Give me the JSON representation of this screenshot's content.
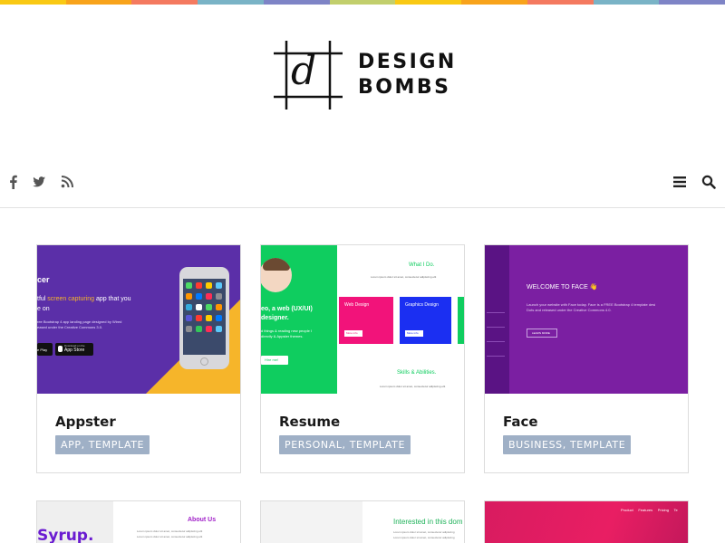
{
  "brand": {
    "name_line1": "DESIGN",
    "name_line2": "BOMBS",
    "logo_letter": "d"
  },
  "rainbow_colors": [
    "#f9c914",
    "#f8a31b",
    "#f47a60",
    "#7ab3c6",
    "#7e84c6",
    "#c2cf6d",
    "#f9c914",
    "#f8a31b",
    "#f47a60",
    "#7ab3c6",
    "#7e84c6"
  ],
  "toolbar": {
    "icons": [
      "facebook-icon",
      "twitter-icon",
      "rss-icon",
      "menu-icon",
      "search-icon"
    ]
  },
  "cards": [
    {
      "title": "Appster",
      "tags": "APP, TEMPLATE",
      "preview": {
        "heading": "cer",
        "line1a": "tful ",
        "line1b": "screen capturing",
        "line1c": " app that you",
        "line2": "e on",
        "small1": "ree Bootstrap 4 app landing page designed by Wired",
        "small2": "eased under the Creative Commons 3.0.",
        "store1": "e Play",
        "store2": "App Store",
        "store2_top": "Download on the"
      }
    },
    {
      "title": "Resume",
      "tags": "PERSONAL, TEMPLATE",
      "preview": {
        "intro1": "eo, a web (UX/UI)",
        "intro2": "designer.",
        "intro3": "d things & reading new people I",
        "intro4": "directly & Appster themes.",
        "button": "Hire me!",
        "what": "What I Do.",
        "lorem": "Lorem ipsum dolor sit amet, consectetur adipiscing elit",
        "box1": "Web Design",
        "box2": "Graphics Design",
        "more": "More info",
        "skills": "Skills & Abilities."
      }
    },
    {
      "title": "Face",
      "tags": "BUSINESS, TEMPLATE",
      "preview": {
        "heading": "WELCOME TO FACE 👋",
        "body1": "Launch your website with Face today. Face is a FREE Bootstrap 4 template desi",
        "body2": "Dots and released under the Creative Commons 4.0.",
        "button": "LEARN MORE"
      }
    }
  ],
  "second_row": [
    {
      "heading": "Syrup.",
      "about": "About Us",
      "text": "Lorem ipsum dolor sit amet, consectetur adipiscing elit"
    },
    {
      "heading": "Interested in this dom",
      "text": "Lorem ipsum dolor sit amet, consectetur adipiscing"
    },
    {
      "nav": [
        "Product",
        "Features",
        "Pricing",
        "Te"
      ]
    }
  ]
}
